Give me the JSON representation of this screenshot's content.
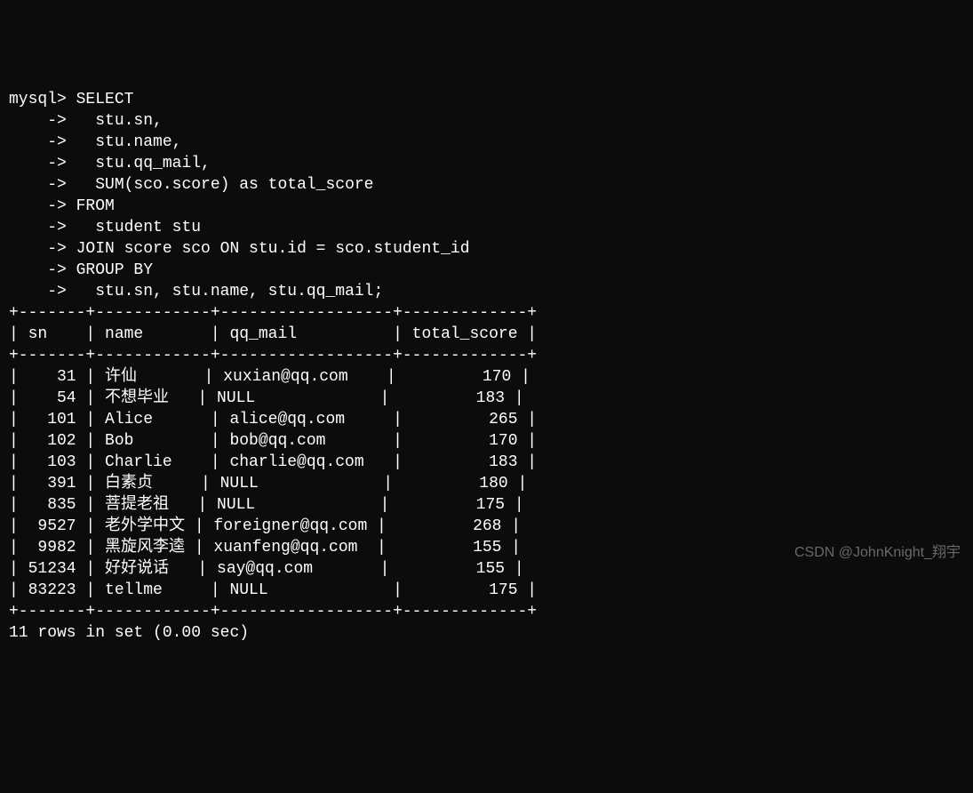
{
  "prompt_main": "mysql> ",
  "prompt_cont": "    -> ",
  "query_lines": [
    "SELECT",
    "  stu.sn,",
    "  stu.name,",
    "  stu.qq_mail,",
    "  SUM(sco.score) as total_score",
    "FROM",
    "  student stu",
    "JOIN score sco ON stu.id = sco.student_id",
    "GROUP BY",
    "  stu.sn, stu.name, stu.qq_mail;"
  ],
  "table": {
    "border_top": "+-------+------------+------------------+-------------+",
    "border_header": "+-------+------------+------------------+-------------+",
    "border_bottom": "+-------+------------+------------------+-------------+",
    "header": {
      "sn": "sn",
      "name": "name",
      "qq_mail": "qq_mail",
      "total_score": "total_score"
    },
    "rows": [
      {
        "sn": "31",
        "name": "许仙",
        "qq_mail": "xuxian@qq.com",
        "total_score": "170"
      },
      {
        "sn": "54",
        "name": "不想毕业",
        "qq_mail": "NULL",
        "total_score": "183"
      },
      {
        "sn": "101",
        "name": "Alice",
        "qq_mail": "alice@qq.com",
        "total_score": "265"
      },
      {
        "sn": "102",
        "name": "Bob",
        "qq_mail": "bob@qq.com",
        "total_score": "170"
      },
      {
        "sn": "103",
        "name": "Charlie",
        "qq_mail": "charlie@qq.com",
        "total_score": "183"
      },
      {
        "sn": "391",
        "name": "白素贞",
        "qq_mail": "NULL",
        "total_score": "180"
      },
      {
        "sn": "835",
        "name": "菩提老祖",
        "qq_mail": "NULL",
        "total_score": "175"
      },
      {
        "sn": "9527",
        "name": "老外学中文",
        "qq_mail": "foreigner@qq.com",
        "total_score": "268"
      },
      {
        "sn": "9982",
        "name": "黑旋风李逵",
        "qq_mail": "xuanfeng@qq.com",
        "total_score": "155"
      },
      {
        "sn": "51234",
        "name": "好好说话",
        "qq_mail": "say@qq.com",
        "total_score": "155"
      },
      {
        "sn": "83223",
        "name": "tellme",
        "qq_mail": "NULL",
        "total_score": "175"
      }
    ]
  },
  "footer": "11 rows in set (0.00 sec)",
  "watermark": "CSDN @JohnKnight_翔宇",
  "chart_data": {
    "type": "table",
    "title": "MySQL query result",
    "columns": [
      "sn",
      "name",
      "qq_mail",
      "total_score"
    ],
    "rows": [
      [
        31,
        "许仙",
        "xuxian@qq.com",
        170
      ],
      [
        54,
        "不想毕业",
        null,
        183
      ],
      [
        101,
        "Alice",
        "alice@qq.com",
        265
      ],
      [
        102,
        "Bob",
        "bob@qq.com",
        170
      ],
      [
        103,
        "Charlie",
        "charlie@qq.com",
        183
      ],
      [
        391,
        "白素贞",
        null,
        180
      ],
      [
        835,
        "菩提老祖",
        null,
        175
      ],
      [
        9527,
        "老外学中文",
        "foreigner@qq.com",
        268
      ],
      [
        9982,
        "黑旋风李逵",
        "xuanfeng@qq.com",
        155
      ],
      [
        51234,
        "好好说话",
        "say@qq.com",
        155
      ],
      [
        83223,
        "tellme",
        null,
        175
      ]
    ]
  }
}
